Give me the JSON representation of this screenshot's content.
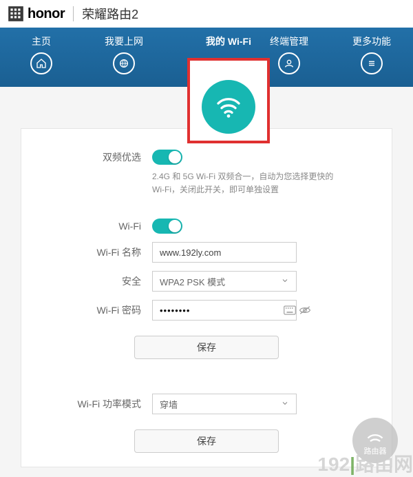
{
  "brand": {
    "logo_label": "honor",
    "product": "荣耀路由2"
  },
  "nav": {
    "items": [
      {
        "label": "主页"
      },
      {
        "label": "我要上网"
      },
      {
        "label": "我的 Wi-Fi"
      },
      {
        "label": "终端管理"
      },
      {
        "label": "更多功能"
      }
    ]
  },
  "wifi_panel": {
    "dual_band": {
      "label": "双频优选",
      "state": "on",
      "hint1": "2.4G 和 5G Wi-Fi 双频合一，自动为您选择更快的",
      "hint2": "Wi-Fi，关闭此开关，即可单独设置"
    },
    "wifi_switch": {
      "label": "Wi-Fi",
      "state": "on"
    },
    "ssid": {
      "label": "Wi-Fi 名称",
      "value": "www.192ly.com"
    },
    "security": {
      "label": "安全",
      "value": "WPA2 PSK 模式"
    },
    "password": {
      "label": "Wi-Fi 密码",
      "value": "••••••••"
    },
    "save1": "保存",
    "power_mode": {
      "label": "Wi-Fi 功率模式",
      "value": "穿墙"
    },
    "save2": "保存"
  },
  "watermark": {
    "circle": "路由器",
    "site_a": "192",
    "site_b": "路由网"
  }
}
